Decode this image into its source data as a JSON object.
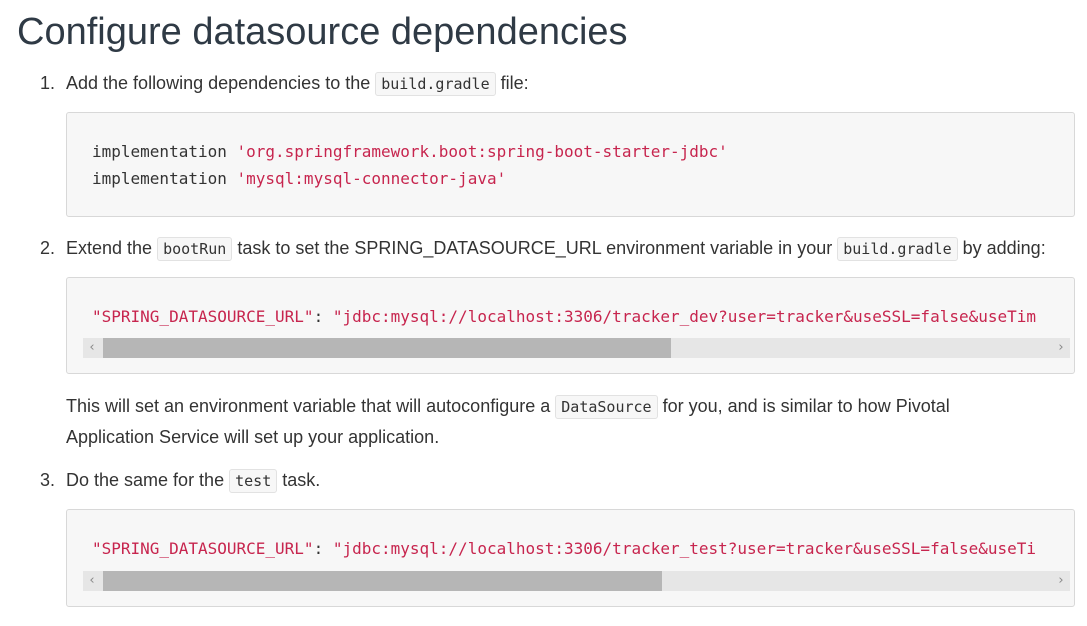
{
  "title": "Configure datasource dependencies",
  "steps": [
    {
      "number": "1.",
      "text_before": "Add the following dependencies to the",
      "code": "build.gradle",
      "text_after": "file:"
    },
    {
      "number": "2.",
      "text_before": "Extend the",
      "code1": "bootRun",
      "text_middle": "task to set the SPRING_DATASOURCE_URL environment variable in your",
      "code2": "build.gradle",
      "text_after": "by adding:"
    },
    {
      "number": "3.",
      "text_before": "Do the same for the",
      "code": "test",
      "text_after": "task."
    }
  ],
  "code_block_1": {
    "lines": [
      {
        "keyword": "implementation",
        "string": "'org.springframework.boot:spring-boot-starter-jdbc'"
      },
      {
        "keyword": "implementation",
        "string": "'mysql:mysql-connector-java'"
      }
    ]
  },
  "code_block_2": {
    "key": "\"SPRING_DATASOURCE_URL\"",
    "sep": ": ",
    "value": "\"jdbc:mysql://localhost:3306/tracker_dev?user=tracker&useSSL=false&useTim",
    "scroll_fraction": 0.6
  },
  "note": {
    "text_before": "This will set an environment variable that will autoconfigure a",
    "code": "DataSource",
    "text_after": "for you, and is similar to how Pivotal Application Service will set up your application."
  },
  "code_block_3": {
    "key": "\"SPRING_DATASOURCE_URL\"",
    "sep": ": ",
    "value": "\"jdbc:mysql://localhost:3306/tracker_test?user=tracker&useSSL=false&useTi",
    "scroll_fraction": 0.59
  },
  "scroll_left_icon": "chevron-left-icon",
  "scroll_right_icon": "chevron-right-icon"
}
